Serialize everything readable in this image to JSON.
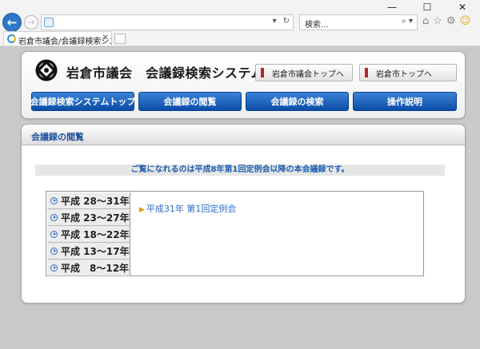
{
  "browser": {
    "window_controls": [
      "—",
      "☐",
      "✕"
    ],
    "address_icons": [
      "▾",
      "↻"
    ],
    "search_placeholder": "検索...",
    "search_icon": "⌕ ▾",
    "tool_icons": [
      "⌂",
      "☆",
      "⚙",
      "☺"
    ],
    "tab_title": "岩倉市議会/会議録検索シス...",
    "tab_close": "✕"
  },
  "header": {
    "title": "岩倉市議会　会議録検索システム",
    "links": {
      "council_top": "岩倉市議会トップへ",
      "city_top": "岩倉市トップへ"
    }
  },
  "menu": [
    "会議録検索システムトップ",
    "会議録の閲覧",
    "会議録の検索",
    "操作説明"
  ],
  "content": {
    "section_title": "会議録の閲覧",
    "notice": "ご覧になれるのは平成8年第1回定例会以降の本会議録です。",
    "year_ranges": [
      "平成 28～31年",
      "平成 23～27年",
      "平成 18～22年",
      "平成 13～17年",
      "平成　8～12年"
    ],
    "session_link": "平成31年 第1回定例会"
  },
  "colors": {
    "menu_blue": "#0b4da8",
    "heading_blue": "#1f4f9a",
    "link_blue": "#2a6dcf",
    "marker_red": "#b3262b"
  }
}
